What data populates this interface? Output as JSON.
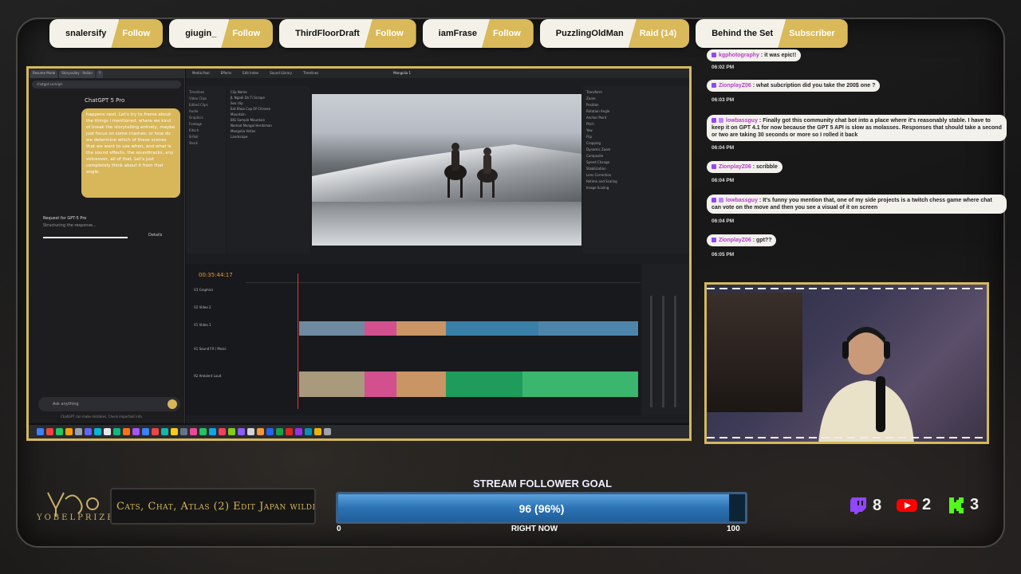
{
  "alerts": [
    {
      "name": "snalersify",
      "type": "Follow"
    },
    {
      "name": "giugin_",
      "type": "Follow"
    },
    {
      "name": "ThirdFloorDraft",
      "type": "Follow"
    },
    {
      "name": "iamFrase",
      "type": "Follow"
    },
    {
      "name": "PuzzlingOldMan",
      "type": "Raid (14)"
    },
    {
      "name": "Behind the Set",
      "type": "Subscriber"
    }
  ],
  "screen": {
    "browser": {
      "tabs": [
        "Resume Mode",
        "Storyvalley · Italian",
        "Y"
      ],
      "url": "chatgpt.com/g/c",
      "model": "ChatGPT 5 Pro",
      "bubble_text": "happens next. Let's try to frame about the things I mentioned, where we kind of break the storytelling entirely, maybe just focus on some crashes, or how do we determine which of these scenes that we want to use when, and what is the sound effects, the soundtracks, any voiceover, all of that. Let's just completely think about it from that angle.",
      "request_title": "Request for GPT-5 Pro",
      "request_status": "Structuring the response...",
      "details_label": "Details",
      "input_placeholder": "Ask anything",
      "footer": "ChatGPT can make mistakes. Check important info."
    },
    "resolve": {
      "menu": [
        "Media Pool",
        "Effects",
        "Edit Index",
        "Sound Library",
        "Timelines"
      ],
      "project_name": "Mongolia 1",
      "viewer_timecode": "00:35:44:17",
      "timeline_timecode": "00:35:44:17",
      "bins": [
        "Timelines",
        "Video Clips",
        "Edited Clips",
        "Audio",
        "Graphics",
        "Footage",
        "Kitsch",
        "B-Roll",
        "Stock"
      ],
      "clips": [
        "Clip Name",
        "JL Ngadi Da Ti Scrape",
        "Sea clip",
        "Eat Khoa Cup Of Chinese",
        "Mountain",
        "BIG Sample Mountain",
        "Nomad Mongol Herdsman",
        "Mongolia Vistas",
        "Landscape"
      ],
      "inspector": [
        "Transform",
        "Zoom",
        "Position",
        "Rotation Angle",
        "Anchor Point",
        "Pitch",
        "Yaw",
        "Flip",
        "Cropping",
        "Dynamic Zoom",
        "Composite",
        "Speed Change",
        "Stabilization",
        "Lens Correction",
        "Retime and Scaling",
        "Image Scaling"
      ],
      "tracks": [
        "V3",
        "V2",
        "V1",
        "A1",
        "A2"
      ],
      "track_names": [
        "Graphics",
        "Video 2",
        "Video 1",
        "Sound FX / Music",
        "Ambient Loud"
      ],
      "status": "DaVinci Resolve Studio 20"
    }
  },
  "chat": [
    {
      "user": "kgphotography",
      "text": "it was epic!!",
      "time": "06:02 PM"
    },
    {
      "user": "ZionplayZ06",
      "text": "what subcription did you take the 200$ one ?",
      "time": "06:03 PM"
    },
    {
      "user": "lowbassguy",
      "text": "Finally got this community chat bot into a place where it's reasonably stable. I have to keep it on GPT 4.1 for now because the GPT 5 API is slow as molasses. Responses that should take a second or two are taking 30 seconds or more so I rolled it back",
      "time": "06:04 PM"
    },
    {
      "user": "ZionplayZ06",
      "text": "scribble",
      "time": "06:04 PM"
    },
    {
      "user": "lowbassguy",
      "text": "It's funny you mention that, one of my side projects is a twitch chess game where chat can vote on the move and then you see a visual of it on screen",
      "time": "06:04 PM"
    },
    {
      "user": "ZionplayZ06",
      "text": "gpt??",
      "time": "06:05 PM"
    }
  ],
  "brand": {
    "logo_text": "YOBELPRIZE"
  },
  "stream_title": "Cats, Chat, Atlas (2) Edit Japan wildli",
  "goal": {
    "label": "STREAM FOLLOWER GOAL",
    "value_text": "96 (96%)",
    "progress": 0.96,
    "min": "0",
    "max": "100",
    "sub": "RIGHT NOW"
  },
  "platforms": [
    {
      "name": "twitch-icon",
      "count": "8",
      "color": "#9146ff"
    },
    {
      "name": "youtube-icon",
      "count": "2",
      "color": "#ff0000"
    },
    {
      "name": "kick-icon",
      "count": "3",
      "color": "#53fc18"
    }
  ],
  "colors": {
    "accent": "#d4b85e",
    "goal_fill": "#2c73b5",
    "chat_user": "#b540c9"
  }
}
